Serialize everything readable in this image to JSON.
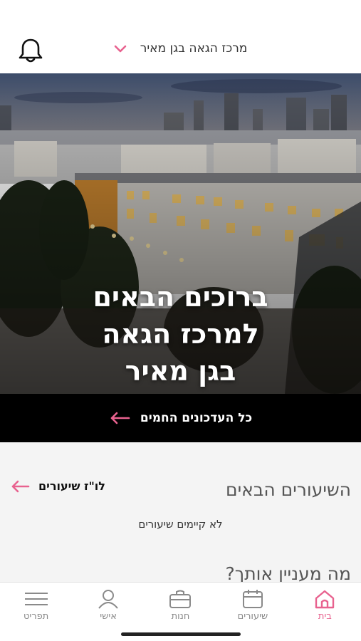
{
  "header": {
    "location_label": "מרכז הגאה בגן מאיר",
    "bell_icon": "bell-icon",
    "dropdown_icon": "chevron-down-icon"
  },
  "hero": {
    "title_line1": "ברוכים הבאים",
    "title_line2": "למרכז הגאה",
    "title_line3": "בגן מאיר"
  },
  "updates": {
    "label": "כל העדכונים החמים",
    "arrow_icon": "arrow-left-icon"
  },
  "classes": {
    "title": "השיעורים הבאים",
    "schedule_link": "לו\"ז שיעורים",
    "empty_message": "לא קיימים שיעורים"
  },
  "interest": {
    "title": "מה מעניין אותך?"
  },
  "tabs": [
    {
      "label": "בית",
      "icon": "home-icon",
      "active": true
    },
    {
      "label": "שיעורים",
      "icon": "calendar-icon",
      "active": false
    },
    {
      "label": "חנות",
      "icon": "shop-bag-icon",
      "active": false
    },
    {
      "label": "אישי",
      "icon": "user-icon",
      "active": false
    },
    {
      "label": "תפריט",
      "icon": "menu-icon",
      "active": false
    }
  ],
  "colors": {
    "accent": "#e8628f",
    "bar": "#000000",
    "content_bg": "#f4f4f4"
  }
}
